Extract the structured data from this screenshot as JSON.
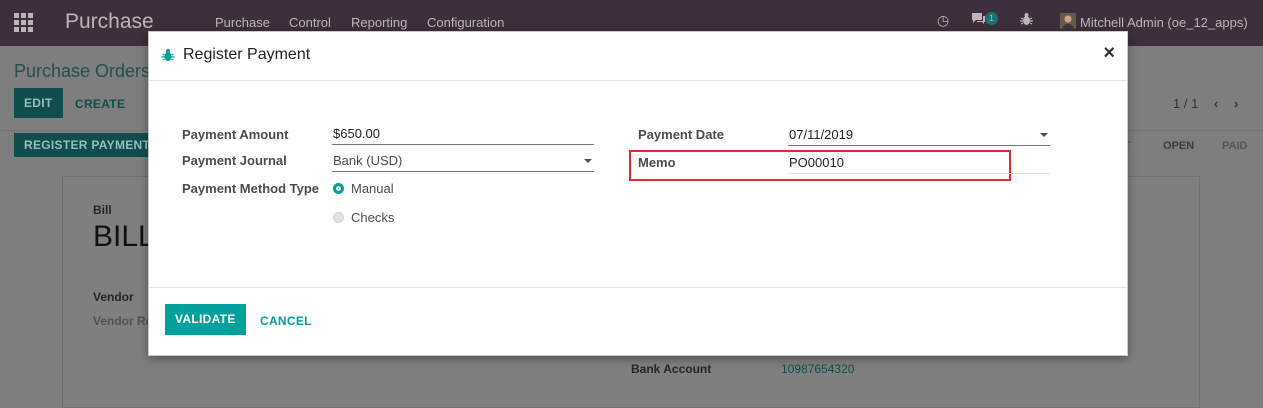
{
  "topbar": {
    "app_title": "Purchase",
    "menus": [
      "Purchase",
      "Control",
      "Reporting",
      "Configuration"
    ],
    "chat_badge": "1",
    "user": "Mitchell Admin (oe_12_apps)"
  },
  "background": {
    "breadcrumb": "Purchase Orders",
    "edit_label": "EDIT",
    "create_label": "CREATE",
    "pager": "1 / 1",
    "register_payment_label": "REGISTER PAYMENT",
    "status_stages": [
      "T",
      "OPEN",
      "PAID"
    ],
    "bill_label": "Bill",
    "bill_title": "BILL",
    "vendor_label": "Vendor",
    "vendor_ref_label": "Vendor Re",
    "bank_account_label": "Bank Account",
    "bank_account_value": "10987654320"
  },
  "dialog": {
    "title": "Register Payment",
    "close_glyph": "×",
    "payment_amount_label": "Payment Amount",
    "payment_amount_currency": "$",
    "payment_amount_value": "650.00",
    "payment_journal_label": "Payment Journal",
    "payment_journal_value": "Bank (USD)",
    "payment_method_label": "Payment Method Type",
    "payment_methods": [
      {
        "label": "Manual",
        "selected": true
      },
      {
        "label": "Checks",
        "selected": false
      }
    ],
    "payment_date_label": "Payment Date",
    "payment_date_value": "07/11/2019",
    "memo_label": "Memo",
    "memo_value": "PO00010",
    "validate_label": "VALIDATE",
    "cancel_label": "CANCEL"
  },
  "colors": {
    "accent": "#00a09d",
    "topbar": "#3d2f3b",
    "highlight": "#e02b2b"
  }
}
